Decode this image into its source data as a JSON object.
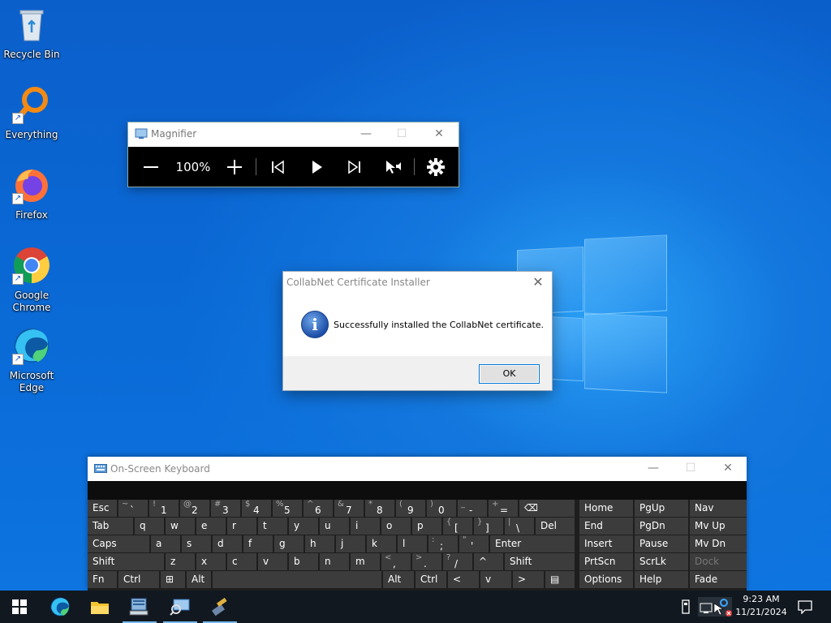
{
  "desktop_icons": [
    {
      "label": "Recycle Bin",
      "icon": "recycle-bin-icon"
    },
    {
      "label": "Everything",
      "icon": "everything-icon"
    },
    {
      "label": "Firefox",
      "icon": "firefox-icon"
    },
    {
      "label": "Google Chrome",
      "icon": "chrome-icon"
    },
    {
      "label": "Microsoft Edge",
      "icon": "edge-icon"
    }
  ],
  "magnifier": {
    "title": "Magnifier",
    "zoom": "100%",
    "controls": [
      "zoom-out",
      "zoom-in",
      "previous",
      "play",
      "next",
      "read-from-here",
      "settings"
    ]
  },
  "dialog": {
    "title": "CollabNet Certificate Installer",
    "message": "Successfully installed the CollabNet certificate.",
    "ok_label": "OK"
  },
  "osk": {
    "title": "On-Screen Keyboard",
    "row1": [
      {
        "label": "Esc"
      },
      {
        "shift": "~",
        "main": "`"
      },
      {
        "shift": "!",
        "main": "1"
      },
      {
        "shift": "@",
        "main": "2"
      },
      {
        "shift": "#",
        "main": "3"
      },
      {
        "shift": "$",
        "main": "4"
      },
      {
        "shift": "%",
        "main": "5"
      },
      {
        "shift": "^",
        "main": "6"
      },
      {
        "shift": "&",
        "main": "7"
      },
      {
        "shift": "*",
        "main": "8"
      },
      {
        "shift": "(",
        "main": "9"
      },
      {
        "shift": ")",
        "main": "0"
      },
      {
        "shift": "_",
        "main": "-"
      },
      {
        "shift": "+",
        "main": "="
      },
      {
        "label": "⌫"
      }
    ],
    "row2": [
      "Tab",
      "q",
      "w",
      "e",
      "r",
      "t",
      "y",
      "u",
      "i",
      "o",
      "p",
      "[",
      "]",
      "\\",
      "Del"
    ],
    "row2_shift": {
      "[": "{",
      "]": "}",
      "\\": "|"
    },
    "row3": [
      "Caps",
      "a",
      "s",
      "d",
      "f",
      "g",
      "h",
      "j",
      "k",
      "l",
      ";",
      "'",
      "Enter"
    ],
    "row3_shift": {
      ";": ":",
      "'": "\""
    },
    "row4": [
      "Shift",
      "z",
      "x",
      "c",
      "v",
      "b",
      "n",
      "m",
      ",",
      ".",
      "/",
      "^",
      "Shift"
    ],
    "row4_shift": {
      ",": "<",
      ".": ">",
      "/": "?"
    },
    "row5": [
      "Fn",
      "Ctrl",
      "⊞",
      "Alt",
      "",
      "Alt",
      "Ctrl",
      "<",
      "v",
      ">",
      "▤"
    ],
    "nav": [
      [
        "Home",
        "PgUp",
        "Nav"
      ],
      [
        "End",
        "PgDn",
        "Mv Up"
      ],
      [
        "Insert",
        "Pause",
        "Mv Dn"
      ],
      [
        "PrtScn",
        "ScrLk",
        "Dock"
      ],
      [
        "Options",
        "Help",
        "Fade"
      ]
    ]
  },
  "taskbar": {
    "apps": [
      "start-icon",
      "edge-icon",
      "file-explorer-icon",
      "server-manager-icon",
      "magnifier-icon",
      "pinned-app-icon"
    ],
    "time": "9:23 AM",
    "date": "11/21/2024"
  }
}
